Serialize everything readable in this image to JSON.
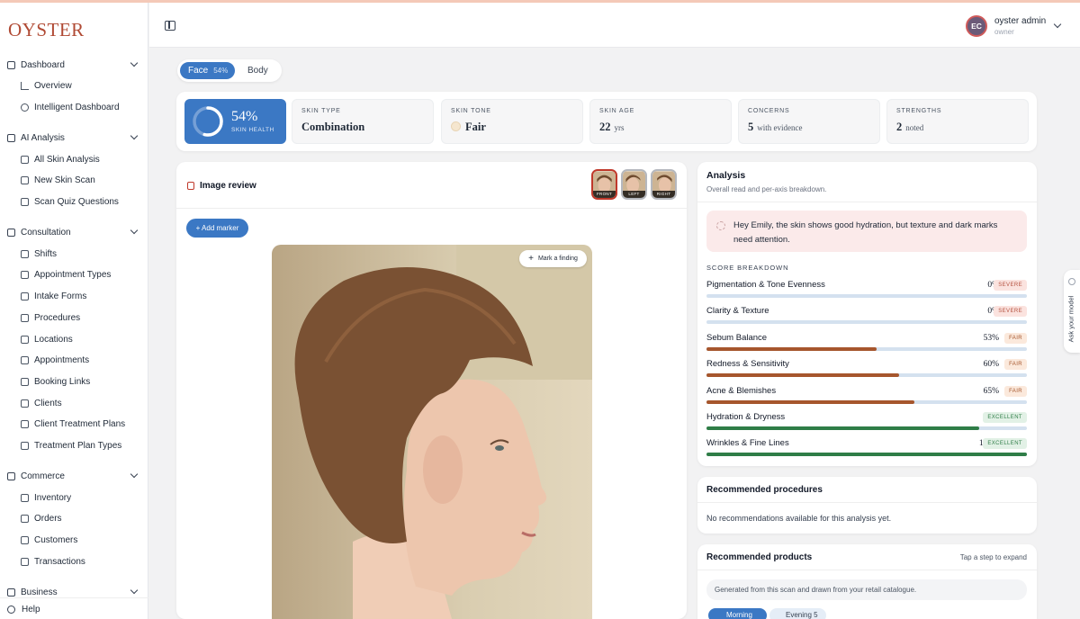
{
  "brand": {
    "logo": "OYSTER"
  },
  "sidebar": {
    "sections": [
      {
        "label": "Dashboard",
        "items": [
          "Overview",
          "Intelligent Dashboard"
        ]
      },
      {
        "label": "AI Analysis",
        "items": [
          "All Skin Analysis",
          "New Skin Scan",
          "Scan Quiz Questions"
        ]
      },
      {
        "label": "Consultation",
        "items": [
          "Shifts",
          "Appointment Types",
          "Intake Forms",
          "Procedures",
          "Locations",
          "Appointments",
          "Booking Links",
          "Clients",
          "Client Treatment Plans",
          "Treatment Plan Types"
        ]
      },
      {
        "label": "Commerce",
        "items": [
          "Inventory",
          "Orders",
          "Customers",
          "Transactions"
        ]
      },
      {
        "label": "Business",
        "items": []
      }
    ],
    "help": "Help"
  },
  "topbar": {
    "user": {
      "initials": "EC",
      "name": "oyster admin",
      "role": "owner"
    }
  },
  "tabs": {
    "face_label": "Face",
    "face_pct": "54%",
    "body_label": "Body"
  },
  "summary": {
    "health_value": "54%",
    "health_fraction": 0.54,
    "health_label": "SKIN HEALTH",
    "skin_type": {
      "label": "SKIN TYPE",
      "value": "Combination"
    },
    "skin_tone": {
      "label": "SKIN TONE",
      "value": "Fair"
    },
    "skin_age": {
      "label": "SKIN AGE",
      "value": "22",
      "unit": "yrs"
    },
    "concerns": {
      "label": "CONCERNS",
      "value": "5",
      "note": "with evidence"
    },
    "strengths": {
      "label": "STRENGTHS",
      "value": "2",
      "note": "noted"
    }
  },
  "image_review": {
    "title": "Image review",
    "thumbs": [
      "FRONT",
      "LEFT",
      "RIGHT"
    ],
    "add_marker": "+ Add marker",
    "mark_finding": "Mark a finding"
  },
  "analysis": {
    "title": "Analysis",
    "subtitle": "Overall read and per-axis breakdown.",
    "greeting": "Hey Emily, the skin shows good hydration, but texture and dark marks need attention.",
    "breakdown_title": "SCORE BREAKDOWN",
    "rows": [
      {
        "name": "Pigmentation & Tone Evenness",
        "value": "0%",
        "fraction": 0.0,
        "badge": "SEVERE",
        "level": "sev",
        "color": "#b5513f"
      },
      {
        "name": "Clarity & Texture",
        "value": "0%",
        "fraction": 0.0,
        "badge": "SEVERE",
        "level": "sev",
        "color": "#b5513f"
      },
      {
        "name": "Sebum Balance",
        "value": "53%",
        "fraction": 0.53,
        "badge": "FAIR",
        "level": "fair",
        "color": "#a6562d"
      },
      {
        "name": "Redness & Sensitivity",
        "value": "60%",
        "fraction": 0.6,
        "badge": "FAIR",
        "level": "fair",
        "color": "#a6562d"
      },
      {
        "name": "Acne & Blemishes",
        "value": "65%",
        "fraction": 0.65,
        "badge": "FAIR",
        "level": "fair",
        "color": "#a6562d"
      },
      {
        "name": "Hydration & Dryness",
        "value": "85%",
        "fraction": 0.85,
        "badge": "EXCELLENT",
        "level": "exc",
        "color": "#2f7d47"
      },
      {
        "name": "Wrinkles & Fine Lines",
        "value": "100%",
        "fraction": 1.0,
        "badge": "EXCELLENT",
        "level": "exc",
        "color": "#2f7d47"
      }
    ]
  },
  "procedures": {
    "title": "Recommended procedures",
    "empty": "No recommendations available for this analysis yet."
  },
  "products": {
    "title": "Recommended products",
    "hint": "Tap a step to expand",
    "note": "Generated from this scan and drawn from your retail catalogue.",
    "morning": "Morning",
    "evening": "Evening 5"
  },
  "ask_model": "Ask your model",
  "colors": {
    "accent": "#3b78c4",
    "brand": "#b04a34"
  }
}
